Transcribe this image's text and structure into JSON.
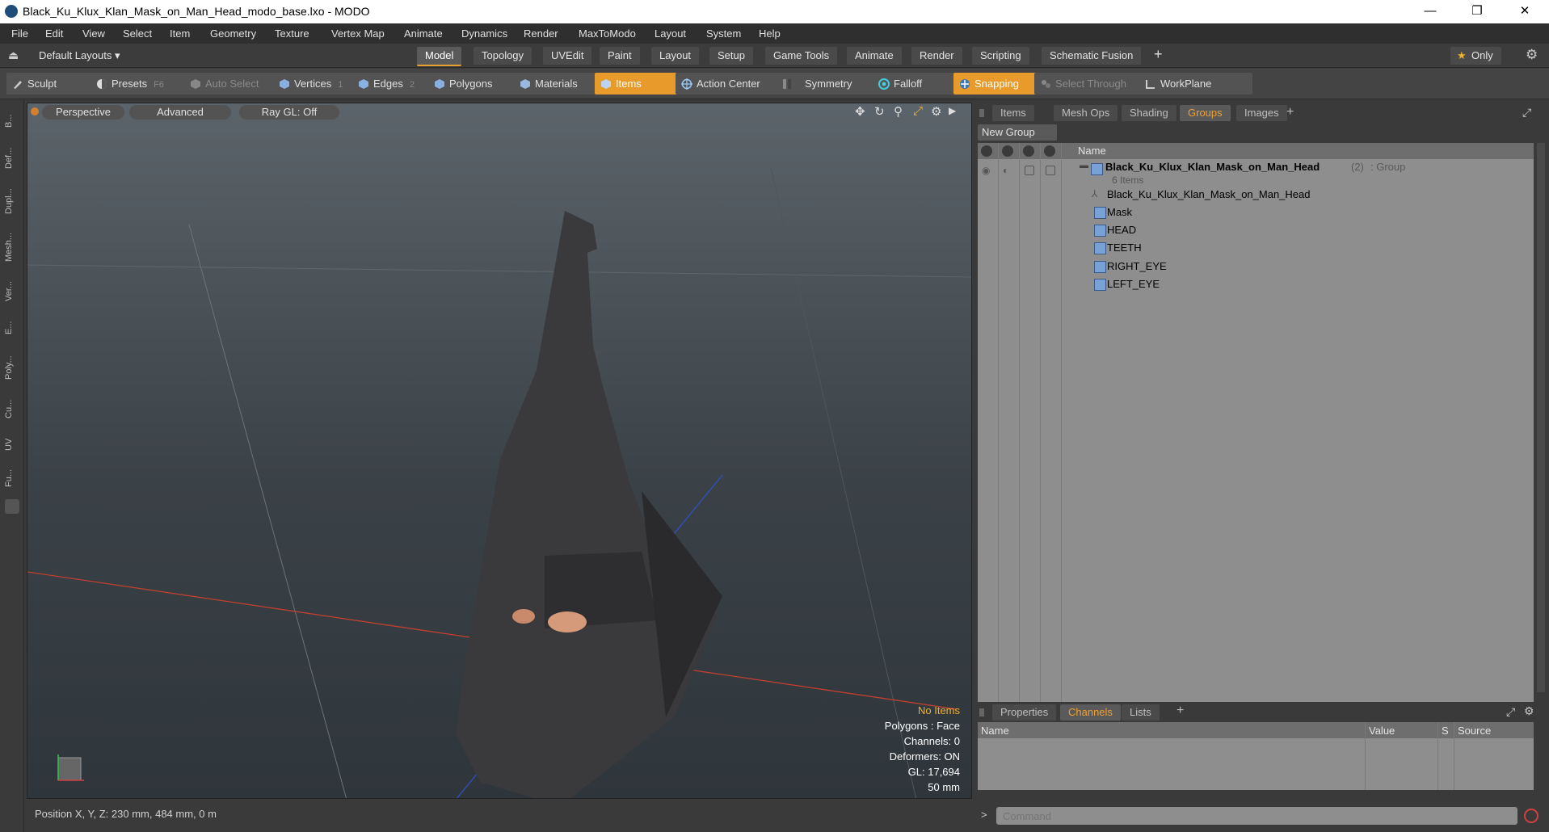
{
  "window": {
    "title": "Black_Ku_Klux_Klan_Mask_on_Man_Head_modo_base.lxo - MODO",
    "minimize": "—",
    "maximize": "❐",
    "close": "✕"
  },
  "menu": [
    "File",
    "Edit",
    "View",
    "Select",
    "Item",
    "Geometry",
    "Texture",
    "Vertex Map",
    "Animate",
    "Dynamics",
    "Render",
    "MaxToModo",
    "Layout",
    "System",
    "Help"
  ],
  "layouts": {
    "default_layouts": "Default Layouts ▾",
    "tabs": [
      "Model",
      "Topology",
      "UVEdit",
      "Paint",
      "Layout",
      "Setup",
      "Game Tools",
      "Animate",
      "Render",
      "Scripting",
      "Schematic Fusion"
    ],
    "active_tab": "Model",
    "add": "+",
    "only": "Only"
  },
  "toolbar": {
    "sculpt": "Sculpt",
    "presets": "Presets",
    "presets_key": "F6",
    "auto_select": "Auto Select",
    "vertices": "Vertices",
    "vertices_key": "1",
    "edges": "Edges",
    "edges_key": "2",
    "polygons": "Polygons",
    "materials": "Materials",
    "items": "Items",
    "action_center": "Action Center",
    "symmetry": "Symmetry",
    "falloff": "Falloff",
    "snapping": "Snapping",
    "select_through": "Select Through",
    "workplane": "WorkPlane"
  },
  "left_strip": [
    "B...",
    "Def...",
    "Dupl...",
    "Mesh...",
    "Ver...",
    "E...",
    "Poly...",
    "Cu...",
    "UV",
    "Fu..."
  ],
  "viewport": {
    "perspective": "Perspective",
    "advanced": "Advanced",
    "raygl": "Ray GL: Off",
    "info": {
      "no_items": "No Items",
      "polygons": "Polygons : Face",
      "channels": "Channels: 0",
      "deformers": "Deformers: ON",
      "gl": "GL: 17,694",
      "scale": "50 mm"
    }
  },
  "status": {
    "position": "Position X, Y, Z:   230 mm, 484 mm, 0 m"
  },
  "right_panel": {
    "tabs": [
      "Items",
      "Mesh Ops",
      "Shading",
      "Groups",
      "Images"
    ],
    "active_tab": "Groups",
    "add": "+",
    "new_group": "New Group",
    "name_col": "Name",
    "group": {
      "name": "Black_Ku_Klux_Klan_Mask_on_Man_Head",
      "count": "(2)",
      "type": ": Group",
      "sub": "6 Items"
    },
    "children": [
      "Black_Ku_Klux_Klan_Mask_on_Man_Head",
      "Mask",
      "HEAD",
      "TEETH",
      "RIGHT_EYE",
      "LEFT_EYE"
    ]
  },
  "channels_panel": {
    "tabs": [
      "Properties",
      "Channels",
      "Lists"
    ],
    "active_tab": "Channels",
    "add": "+",
    "cols": {
      "name": "Name",
      "value": "Value",
      "s": "S",
      "source": "Source"
    }
  },
  "command": {
    "prompt": ">",
    "placeholder": "Command"
  }
}
